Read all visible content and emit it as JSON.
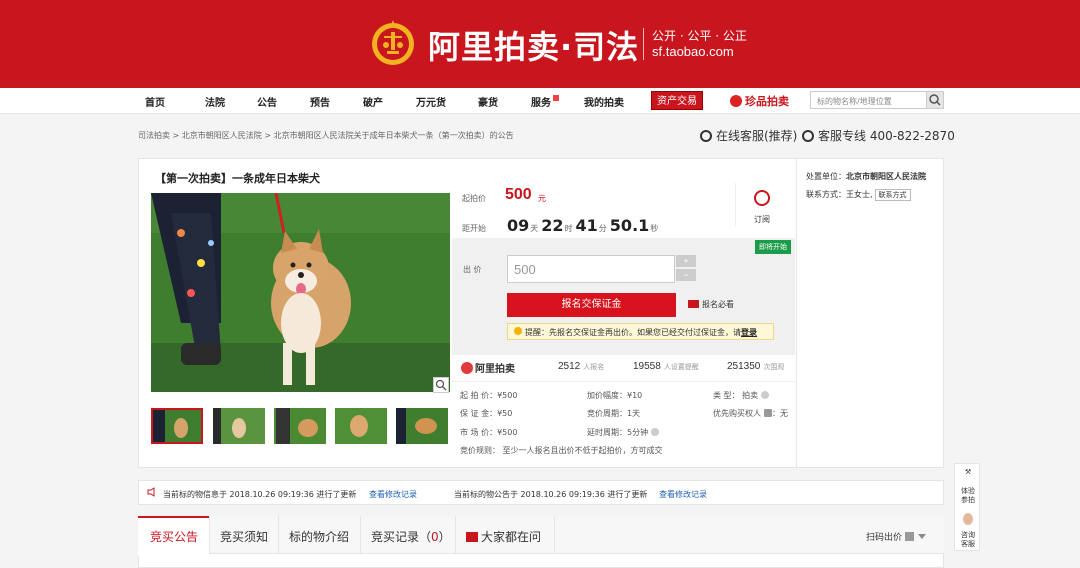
{
  "header": {
    "brand": "阿里拍卖·司法",
    "slogan": "公开 · 公平 · 公正",
    "url": "sf.taobao.com"
  },
  "nav": {
    "items": [
      "首页",
      "法院",
      "公告",
      "预告",
      "破产",
      "万元货",
      "豪货",
      "服务",
      "我的拍卖"
    ],
    "asset": "资产交易",
    "gem": "珍品拍卖",
    "search_placeholder": "标的物名称/地理位置"
  },
  "breadcrumb": "司法拍卖 > 北京市朝阳区人民法院 > 北京市朝阳区人民法院关于成年日本柴犬一条（第一次拍卖）的公告",
  "service": {
    "online": "在线客服(推荐)",
    "hotline": "客服专线 400-822-2870"
  },
  "item": {
    "title": "【第一次拍卖】一条成年日本柴犬",
    "start_label": "起拍价",
    "price": "500",
    "price_unit": "元",
    "countdown_label": "距开始",
    "cd_days": "09",
    "cd_days_u": "天",
    "cd_hours": "22",
    "cd_hours_u": "时",
    "cd_min": "41",
    "cd_min_u": "分",
    "cd_sec": "50.1",
    "cd_sec_u": "秒",
    "subscribe": "订阅",
    "badge": "即将开始",
    "bid_label": "出  价",
    "bid_value": "500",
    "plus": "+",
    "minus": "−",
    "register_btn": "报名交保证金",
    "must_read": "报名必看",
    "tip_text": "提醒：先报名交保证金再出价。如果您已经交付过保证金，请",
    "tip_login": "登录",
    "ali_brand": "阿里拍卖",
    "stats": [
      {
        "n": "2512",
        "l": "人报名"
      },
      {
        "n": "19558",
        "l": "人设置提醒"
      },
      {
        "n": "251350",
        "l": "次围观"
      }
    ],
    "info": {
      "start_price": "起 拍 价：¥500",
      "deposit": "保 证 金：¥50",
      "market": "市 场 价：¥500",
      "rule": "竞价规则：   至少一人报名且出价不低于起拍价，方可成交",
      "increment": "加价幅度：¥10",
      "period": "竞价周期：1天",
      "delay": "延时周期：5分钟",
      "type": "类     型：  拍卖",
      "priority": "优先购买权人",
      "priority_val": "：无"
    }
  },
  "side": {
    "unit_label": "处置单位：",
    "unit": "北京市朝阳区人民法院",
    "contact_label": "联系方式：",
    "contact": "王女士,",
    "contact_btn": "联系方式"
  },
  "notices": [
    {
      "text": "当前标的物信息于 2018.10.26 09:19:36 进行了更新",
      "link": "查看修改记录"
    },
    {
      "text": "当前标的物公告于 2018.10.26 09:19:36 进行了更新",
      "link": "查看修改记录"
    }
  ],
  "tabs": [
    "竞买公告",
    "竞买须知",
    "标的物介绍",
    "竞买记录（",
    "0",
    "）",
    "大家都在问"
  ],
  "qr": "扫码出价",
  "float": {
    "a": "体验",
    "b": "参拍",
    "c": "咨询",
    "d": "客服"
  },
  "colors": {
    "brand": "#c9151e",
    "badge": "#1a9c4a",
    "link": "#1d5fb5"
  }
}
